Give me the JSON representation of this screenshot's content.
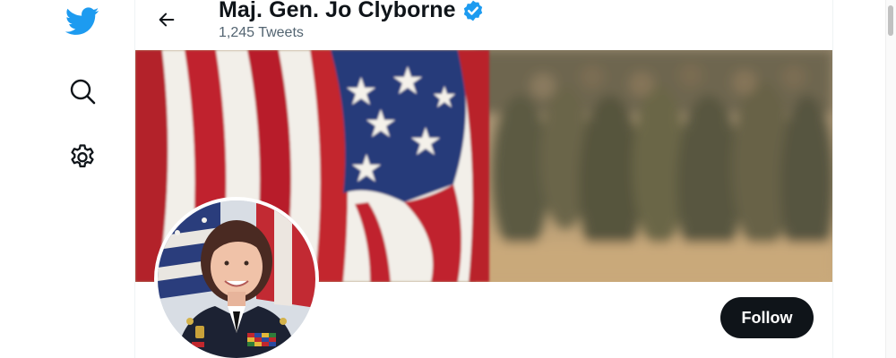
{
  "nav": {
    "logo_icon": "twitter-bird-icon",
    "search_icon": "search-icon",
    "settings_icon": "gear-icon"
  },
  "header": {
    "back_icon": "arrow-left-icon",
    "name": "Maj. Gen. Jo Clyborne",
    "verified_icon": "verified-badge-icon",
    "tweet_count": "1,245 Tweets"
  },
  "profile": {
    "follow_label": "Follow"
  },
  "colors": {
    "brand": "#1d9bf0",
    "text_primary": "#0f1419",
    "text_secondary": "#536471",
    "follow_button_bg": "#0f1419"
  }
}
